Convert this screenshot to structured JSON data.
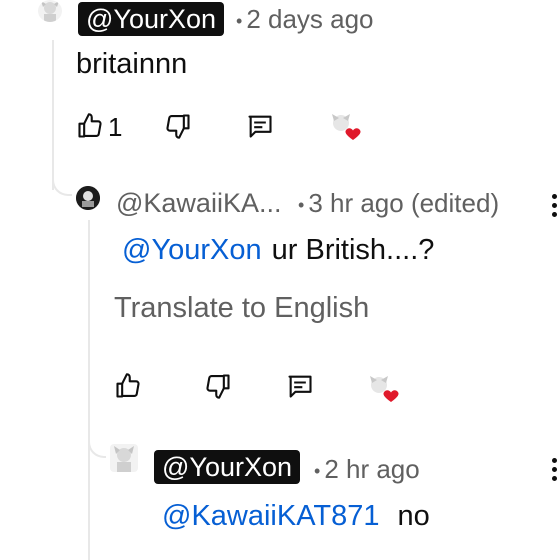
{
  "comments": [
    {
      "author": "@YourXon",
      "time": "2 days ago",
      "text": "britainnn",
      "likes": "1"
    },
    {
      "author": "@KawaiiKA...",
      "time": "3 hr ago (edited)",
      "mention": "@YourXon",
      "text": "ur British....?",
      "translate": "Translate to English"
    },
    {
      "author": "@YourXon",
      "time": "2 hr ago",
      "mention": "@KawaiiKAT871",
      "text": "no"
    }
  ],
  "meta_separator": "•",
  "colors": {
    "mention": "#065fd4",
    "secondary_text": "#606060",
    "heart": "#e0192b",
    "badge_bg": "#0f0f0f"
  },
  "icons": [
    "thumbs-up-icon",
    "thumbs-down-icon",
    "reply-icon",
    "creator-heart-icon",
    "more-menu-icon"
  ]
}
